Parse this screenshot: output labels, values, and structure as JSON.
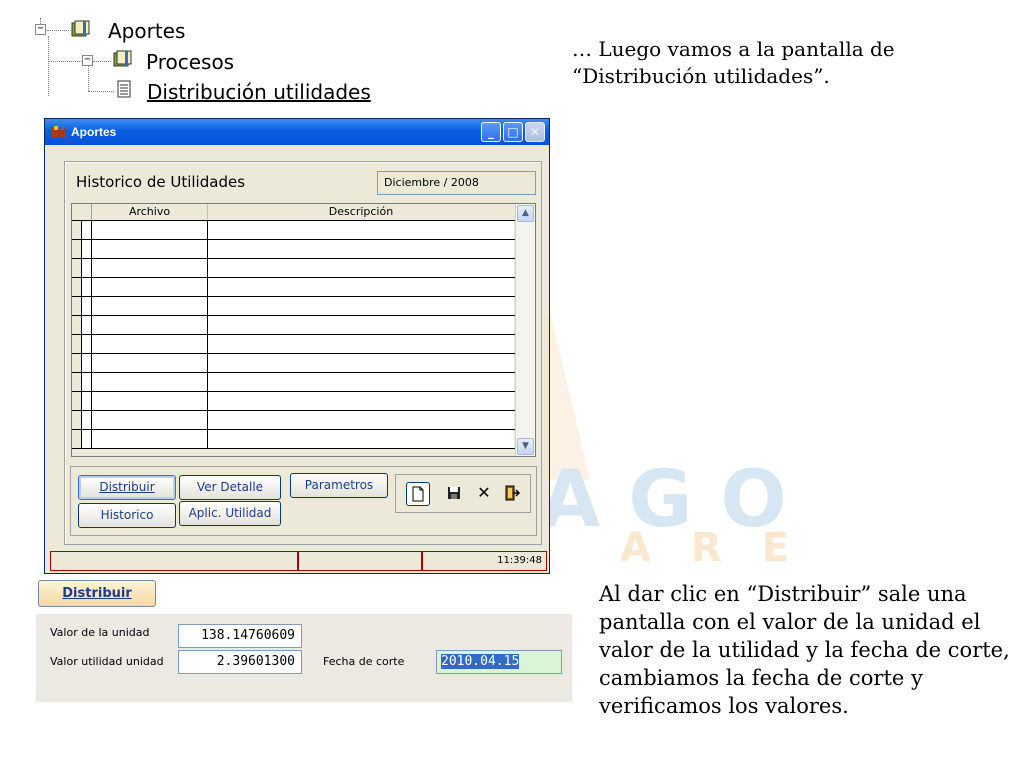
{
  "tree": {
    "items": [
      {
        "label": "Aportes",
        "expander": "−"
      },
      {
        "label": "Procesos",
        "expander": "−"
      },
      {
        "label": "Distribución utilidades"
      }
    ]
  },
  "captions": {
    "top": "… Luego vamos a la pantalla de “Distribución utilidades”.",
    "bottom": "Al dar clic en “Distribuir” sale una pantalla con el valor de la unidad el valor de la utilidad y la fecha de corte, cambiamos la fecha de corte y verificamos los valores."
  },
  "window": {
    "title": "Aportes",
    "controls": {
      "minimize": "_",
      "maximize": "□",
      "close": "✕"
    },
    "panel_title": "Historico de Utilidades",
    "period": "Diciembre / 2008",
    "grid": {
      "columns": [
        "Archivo",
        "Descripción"
      ],
      "row_count": 12
    },
    "buttons": {
      "distribuir": "Distribuir",
      "ver_detalle": "Ver Detalle",
      "parametros": "Parametros",
      "historico": "Historico",
      "aplic_utilidad": "Aplic. Utilidad"
    },
    "toolbar_icons": [
      "new-document-icon",
      "save-icon",
      "delete-icon",
      "exit-icon"
    ],
    "status": {
      "time": "11:39:48"
    }
  },
  "dialog": {
    "button": "Distribuir",
    "valor_unidad_label": "Valor de la unidad",
    "valor_unidad": "138.14760609",
    "valor_utilidad_label": "Valor utilidad unidad",
    "valor_utilidad": "2.39601300",
    "fecha_label": "Fecha de corte",
    "fecha": "2010.04.15"
  },
  "colors": {
    "titlebar": "#0a5fe0",
    "window_bg": "#ece9d8",
    "button_text": "#1f3d8a",
    "date_field_bg": "#d9f5d5",
    "selection": "#316ac5"
  }
}
